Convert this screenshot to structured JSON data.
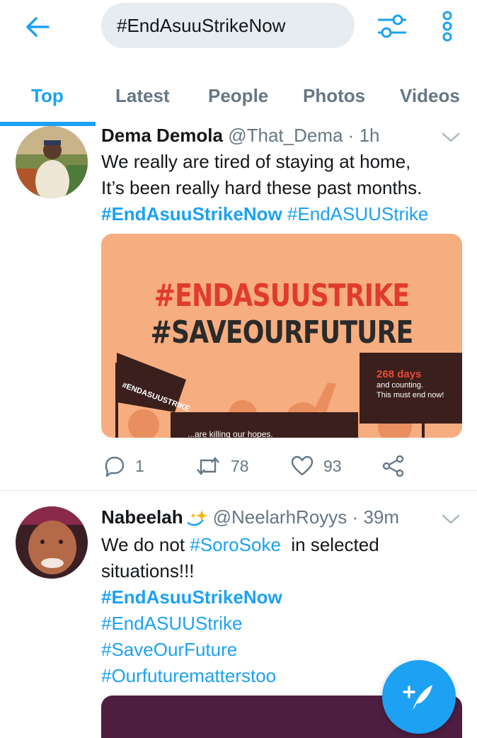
{
  "search": {
    "query": "#EndAsuuStrikeNow"
  },
  "tabs": [
    "Top",
    "Latest",
    "People",
    "Photos",
    "Videos"
  ],
  "tweets": [
    {
      "name": "Dema Demola",
      "handle": "@That_Dema",
      "dot": "·",
      "time": "1h",
      "lines": [
        "We really are tired of staying at home,",
        "It’s been really hard these past months."
      ],
      "tags": [
        "#EndAsuuStrikeNow",
        "#EndASUUStrike"
      ],
      "media": {
        "headline1": "#ENDASUUSTRIKE",
        "headline2": "#SAVEOURFUTURE",
        "flag_text": "#ENDASUUSTRIKE",
        "sign_days": "268 days",
        "sign_line1": "and counting.",
        "sign_line2": "This must end now!",
        "sign_bottom": "...are killing our hopes."
      },
      "replies": "1",
      "retweets": "78",
      "likes": "93"
    },
    {
      "name": "Nabeelah",
      "handle": "@NeelarhRoyys",
      "dot": "·",
      "time": "39m",
      "text_prefix": "We do not ",
      "inline_tag": "#SoroSoke",
      "text_suffix": "  in selected",
      "text_line2": "situations!!!",
      "tags": [
        "#EndAsuuStrikeNow",
        "#EndASUUStrike",
        "#SaveOurFuture",
        "#Ourfuturematterstoo"
      ]
    }
  ],
  "colors": {
    "accent": "#1da1f2",
    "secondary_text": "#657786",
    "divider": "#e1e8ed"
  },
  "icons": {
    "back": "arrow-left-icon",
    "filter": "sliders-icon",
    "more": "more-vertical-icon",
    "compose": "compose-feather-icon"
  }
}
